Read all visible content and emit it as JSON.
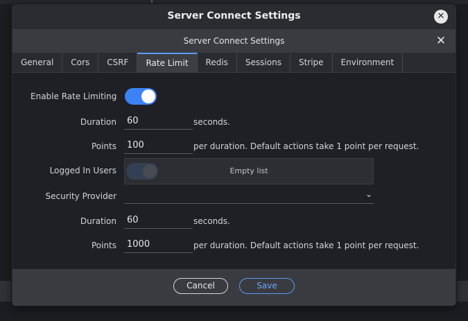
{
  "window": {
    "title": "Server Connect Settings"
  },
  "dialog": {
    "title": "Server Connect Settings"
  },
  "tabs": [
    {
      "label": "General"
    },
    {
      "label": "Cors"
    },
    {
      "label": "CSRF"
    },
    {
      "label": "Rate Limit",
      "active": true
    },
    {
      "label": "Redis"
    },
    {
      "label": "Sessions"
    },
    {
      "label": "Stripe"
    },
    {
      "label": "Environment"
    }
  ],
  "form": {
    "enable_label": "Enable Rate Limiting",
    "enable_value": true,
    "duration_label": "Duration",
    "duration_value": "60",
    "duration_suffix": "seconds.",
    "points_label": "Points",
    "points_value": "100",
    "points_suffix": "per duration. Default actions take 1 point per request.",
    "logged_in_label": "Logged In Users",
    "logged_in_empty": "Empty list",
    "security_provider_label": "Security Provider",
    "security_provider_value": "",
    "duration2_label": "Duration",
    "duration2_value": "60",
    "duration2_suffix": "seconds.",
    "points2_label": "Points",
    "points2_value": "1000",
    "points2_suffix": "per duration. Default actions take 1 point per request."
  },
  "footer": {
    "cancel_label": "Cancel",
    "save_label": "Save"
  },
  "colors": {
    "accent": "#3b82f6",
    "background": "#1f2026"
  },
  "icons": {
    "window_close": "close-icon",
    "dialog_close": "close-icon",
    "select_chevron": "chevron-down-icon"
  }
}
